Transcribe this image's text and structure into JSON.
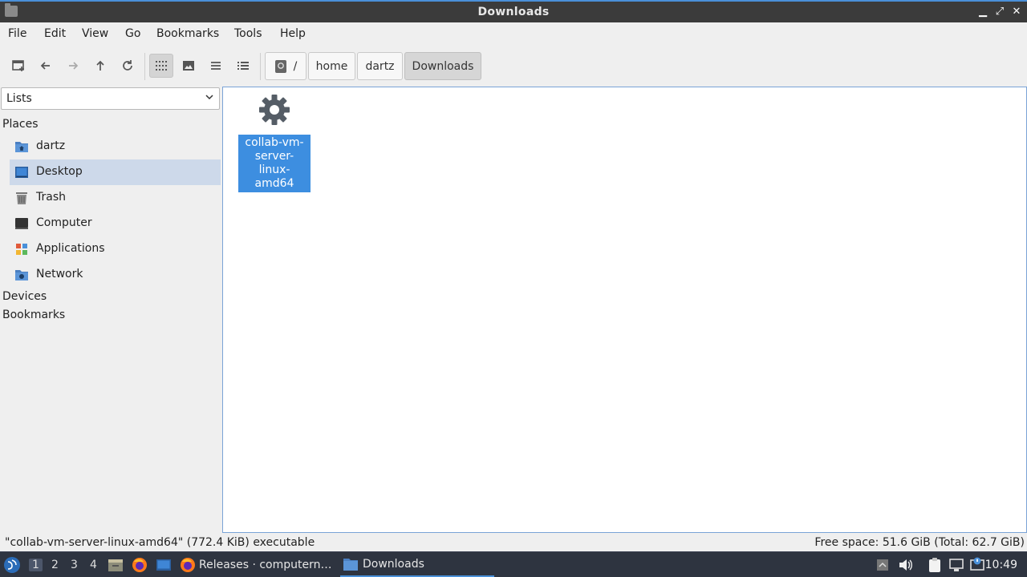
{
  "window": {
    "title": "Downloads",
    "controls": {
      "minimize": "▁",
      "maximize": "⤢",
      "close": "✕"
    }
  },
  "menu": [
    "File",
    "Edit",
    "View",
    "Go",
    "Bookmarks",
    "Tools",
    "Help"
  ],
  "toolbar": {
    "new_tab_icon": "new-tab-icon",
    "back_icon": "arrow-left-icon",
    "forward_icon": "arrow-right-icon",
    "up_icon": "arrow-up-icon",
    "reload_icon": "reload-icon",
    "views": [
      "icon-view",
      "thumbnail-view",
      "compact-view",
      "detailed-list-view"
    ],
    "active_view": "icon-view",
    "breadcrumbs": [
      "/",
      "home",
      "dartz",
      "Downloads"
    ],
    "current_crumb": "Downloads"
  },
  "sidebar": {
    "mode_selected": "Lists",
    "places_header": "Places",
    "places": [
      {
        "label": "dartz",
        "icon": "home-folder-icon"
      },
      {
        "label": "Desktop",
        "icon": "desktop-icon",
        "selected": true
      },
      {
        "label": "Trash",
        "icon": "trash-icon"
      },
      {
        "label": "Computer",
        "icon": "computer-icon"
      },
      {
        "label": "Applications",
        "icon": "applications-icon"
      },
      {
        "label": "Network",
        "icon": "network-icon"
      }
    ],
    "devices_header": "Devices",
    "bookmarks_header": "Bookmarks"
  },
  "files": [
    {
      "name": "collab-vm-server-linux-amd64",
      "name_lines": [
        "collab-vm-",
        "server-linux-",
        "amd64"
      ],
      "icon": "gear-icon",
      "selected": true
    }
  ],
  "status": {
    "left": "\"collab-vm-server-linux-amd64\" (772.4 KiB) executable",
    "right": "Free space: 51.6 GiB (Total: 62.7 GiB)"
  },
  "taskbar": {
    "desktops": [
      "1",
      "2",
      "3",
      "4"
    ],
    "active_desktop": "1",
    "tasks": [
      {
        "label": "Releases · computern…",
        "icon": "firefox-icon",
        "active": false
      },
      {
        "label": "Downloads",
        "icon": "folder-icon",
        "active": true
      }
    ],
    "clock": "10:49"
  },
  "colors": {
    "accent": "#4a90d9",
    "selection": "#3d8ee0",
    "sidebar_selected": "#cdd9ea",
    "taskbar_bg": "#2e3440"
  }
}
